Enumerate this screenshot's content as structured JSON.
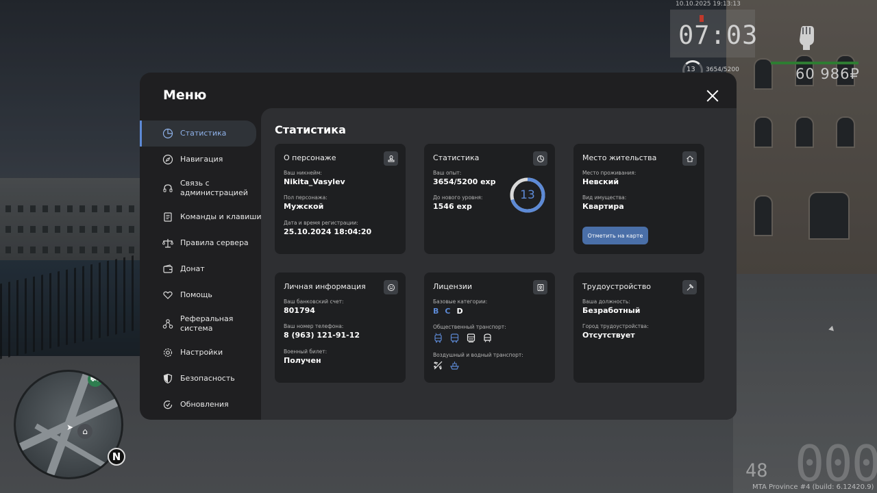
{
  "hud": {
    "datetime": "10.10.2025 19:13:13",
    "time": "07:03",
    "level": "13",
    "exp": "3654/5200",
    "money": "60 986₽",
    "fuel": "48",
    "speed": "000",
    "build": "MTA Province #4 (build: 6.12420.9)",
    "minimap_north": "N",
    "health_fraction": 1.0
  },
  "menu": {
    "title": "Меню",
    "content_title": "Статистика",
    "sidebar": [
      {
        "label": "Статистика",
        "icon": "chart-pie-icon",
        "active": true
      },
      {
        "label": "Навигация",
        "icon": "compass-icon",
        "active": false
      },
      {
        "label": "Связь с администрацией",
        "icon": "headset-icon",
        "active": false
      },
      {
        "label": "Команды и клавиши",
        "icon": "document-list-icon",
        "active": false
      },
      {
        "label": "Правила сервера",
        "icon": "scales-icon",
        "active": false
      },
      {
        "label": "Донат",
        "icon": "wallet-icon",
        "active": false
      },
      {
        "label": "Помощь",
        "icon": "heart-hand-icon",
        "active": false
      },
      {
        "label": "Реферальная система",
        "icon": "referral-icon",
        "active": false
      },
      {
        "label": "Настройки",
        "icon": "gear-icon",
        "active": false
      },
      {
        "label": "Безопасность",
        "icon": "shield-icon",
        "active": false
      },
      {
        "label": "Обновления",
        "icon": "refresh-check-icon",
        "active": false
      }
    ]
  },
  "cards": {
    "character": {
      "title": "О персонаже",
      "nickname_label": "Ваш никнейм:",
      "nickname": "Nikita_Vasylev",
      "gender_label": "Пол персонажа:",
      "gender": "Мужской",
      "reg_label": "Дата и время регистрации:",
      "reg": "25.10.2024 18:04:20"
    },
    "stats": {
      "title": "Статистика",
      "exp_label": "Ваш опыт:",
      "exp": "3654/5200 exp",
      "next_label": "До нового уровня:",
      "next": "1546 exp",
      "level": "13",
      "level_progress": 0.7027
    },
    "residence": {
      "title": "Место жительства",
      "place_label": "Место проживания:",
      "place": "Невский",
      "property_label": "Вид имущества:",
      "property": "Квартира",
      "button": "Отметить на карте"
    },
    "personal": {
      "title": "Личная информация",
      "bank_label": "Ваш банковский счет:",
      "bank": "801794",
      "phone_label": "Ваш номер телефона:",
      "phone": "8 (963) 121-91-12",
      "military_label": "Военный билет:",
      "military": "Получен"
    },
    "licenses": {
      "title": "Лицензии",
      "base_label": "Базовые категории:",
      "categories": [
        "B",
        "C",
        "D"
      ],
      "public_label": "Общественный транспорт:",
      "public_icons": [
        "trolleybus-icon",
        "bus-icon",
        "tram-icon",
        "metro-icon"
      ],
      "air_label": "Воздушный и водный транспорт:",
      "air_icons": [
        "airplane-icon",
        "boat-icon"
      ]
    },
    "employment": {
      "title": "Трудоустройство",
      "position_label": "Ваша должность:",
      "position": "Безработный",
      "city_label": "Город трудоустройства:",
      "city": "Отсутствует"
    }
  },
  "colors": {
    "accent": "#5d8ad6",
    "button": "#4a6fa8",
    "panel": "#1f1f21",
    "content": "#2e2f32",
    "card": "#1e1f21"
  }
}
